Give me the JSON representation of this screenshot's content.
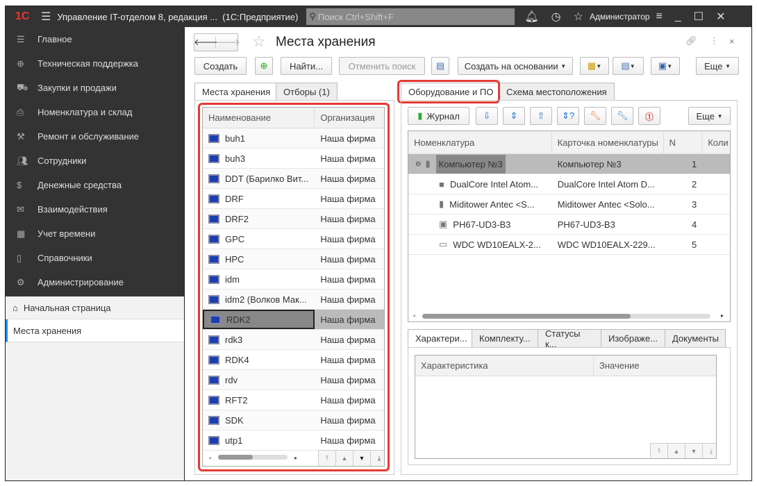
{
  "titlebar": {
    "title": "Управление IT-отделом 8, редакция ...  (1С:Предприятие)",
    "search_placeholder": "Поиск Ctrl+Shift+F",
    "user": "Администратор"
  },
  "sidebar": {
    "items": [
      {
        "label": "Главное",
        "icon": "menu-icon"
      },
      {
        "label": "Техническая поддержка",
        "icon": "lifebuoy-icon"
      },
      {
        "label": "Закупки и продажи",
        "icon": "truck-icon"
      },
      {
        "label": "Номенклатура и склад",
        "icon": "printer-icon"
      },
      {
        "label": "Ремонт и обслуживание",
        "icon": "tools-icon"
      },
      {
        "label": "Сотрудники",
        "icon": "users-icon"
      },
      {
        "label": "Денежные средства",
        "icon": "money-icon"
      },
      {
        "label": "Взаимодействия",
        "icon": "mail-icon"
      },
      {
        "label": "Учет времени",
        "icon": "calendar-icon"
      },
      {
        "label": "Справочники",
        "icon": "book-icon"
      },
      {
        "label": "Администрирование",
        "icon": "gear-icon"
      }
    ],
    "home": "Начальная страница",
    "open": "Места хранения"
  },
  "page": {
    "title": "Места хранения"
  },
  "toolbar": {
    "create": "Создать",
    "find": "Найти...",
    "cancel_search": "Отменить поиск",
    "create_based": "Создать на основании",
    "more": "Еще"
  },
  "left_tabs": [
    "Места хранения",
    "Отборы (1)"
  ],
  "left_grid": {
    "columns": [
      "Наименование",
      "Организация"
    ],
    "rows": [
      [
        "buh1",
        "Наша фирма"
      ],
      [
        "buh3",
        "Наша фирма"
      ],
      [
        "DDT (Барилко Вит...",
        "Наша фирма"
      ],
      [
        "DRF",
        "Наша фирма"
      ],
      [
        "DRF2",
        "Наша фирма"
      ],
      [
        "GPC",
        "Наша фирма"
      ],
      [
        "HPC",
        "Наша фирма"
      ],
      [
        "idm",
        "Наша фирма"
      ],
      [
        "idm2 (Волков Мак...",
        "Наша фирма"
      ],
      [
        "RDK2",
        "Наша фирма"
      ],
      [
        "rdk3",
        "Наша фирма"
      ],
      [
        "RDK4",
        "Наша фирма"
      ],
      [
        "rdv",
        "Наша фирма"
      ],
      [
        "RFT2",
        "Наша фирма"
      ],
      [
        "SDK",
        "Наша фирма"
      ],
      [
        "utp1",
        "Наша фирма"
      ]
    ],
    "selected": "RDK2"
  },
  "right_tabs": [
    "Оборудование и ПО",
    "Схема местоположения"
  ],
  "right_toolbar": {
    "journal": "Журнал",
    "more": "Еще"
  },
  "right_grid": {
    "columns": [
      "Номенклатура",
      "Карточка номенклатуры",
      "N",
      "Коли"
    ],
    "rows": [
      [
        "Компьютер №3",
        "Компьютер №3",
        "1"
      ],
      [
        "DualCore Intel Atom...",
        "DualCore Intel Atom D...",
        "2"
      ],
      [
        "Miditower Antec <S...",
        "Miditower Antec <Solo...",
        "3"
      ],
      [
        "PH67-UD3-B3",
        "PH67-UD3-B3",
        "4"
      ],
      [
        "WDC WD10EALX-2...",
        "WDC WD10EALX-229...",
        "5"
      ]
    ]
  },
  "bottom_tabs": [
    "Характери...",
    "Комплекту...",
    "Статусы к...",
    "Изображе...",
    "Документы"
  ],
  "bottom_grid": {
    "columns": [
      "Характеристика",
      "Значение"
    ]
  },
  "colors": {
    "accent": "#e53935",
    "titlebar": "#333333",
    "selection": "#888888"
  }
}
